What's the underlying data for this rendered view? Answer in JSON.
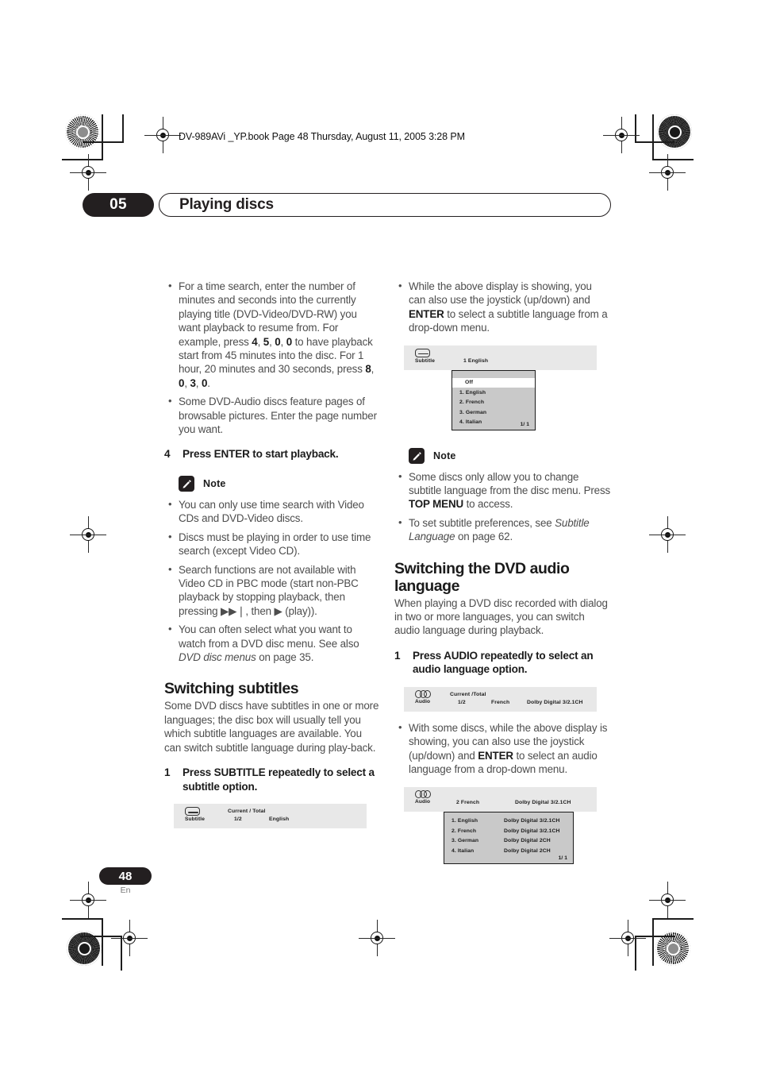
{
  "print_header": {
    "text": "DV-989AVi _YP.book  Page 48  Thursday, August 11, 2005  3:28 PM"
  },
  "chapter": {
    "number": "05",
    "title": "Playing discs"
  },
  "footer": {
    "page_number": "48",
    "language_code": "En"
  },
  "left_column": {
    "bullets_top": [
      "For a time search, enter the number of minutes and seconds into the currently playing title (DVD-Video/DVD-RW) you want playback to resume from. For example, press <b>4</b>, <b>5</b>, <b>0</b>, <b>0</b> to have playback start from 45 minutes into the disc. For 1 hour, 20 minutes and 30 seconds, press <b>8</b>, <b>0</b>, <b>3</b>, <b>0</b>.",
      "Some DVD-Audio discs feature pages of browsable pictures. Enter the page number you want."
    ],
    "step4": {
      "number": "4",
      "text": "Press ENTER to start playback."
    },
    "note_label": "Note",
    "note_bullets": [
      "You can only use time search with Video CDs and DVD-Video discs.",
      "Discs must be playing in order to use time search (except Video CD).",
      "Search functions are not available with Video CD in PBC mode (start non-PBC playback by stopping playback, then pressing ▶▶❘, then ▶ (play)).",
      "You can often select what you want to watch from a DVD disc menu. See also <i>DVD disc menus</i> on page 35."
    ],
    "section_heading": "Switching subtitles",
    "section_body": "Some DVD discs have subtitles in one or more languages; the disc box will usually tell you which subtitle languages are available. You can switch subtitle language during play-back.",
    "step1": {
      "number": "1",
      "text": "Press SUBTITLE repeatedly to select a subtitle option."
    },
    "osd_subtitle_bar": {
      "icon": "subtitle-icon",
      "icon_label": "Subtitle",
      "header_label": "Current / Total",
      "current_total": "1/2",
      "language": "English"
    }
  },
  "right_column": {
    "bullet_top": "While the above display is showing, you can also use the joystick (up/down) and <b>ENTER</b> to select a subtitle language from a drop-down menu.",
    "osd_subtitle_menu": {
      "icon": "subtitle-icon",
      "icon_label": "Subtitle",
      "selection": "1  English",
      "rows": [
        {
          "label": "Off",
          "highlight": true
        },
        {
          "label": "1. English",
          "highlight": false
        },
        {
          "label": "2. French",
          "highlight": false
        },
        {
          "label": "3. German",
          "highlight": false
        },
        {
          "label": "4. Italian",
          "highlight": false
        }
      ],
      "pager": "1/ 1"
    },
    "note_label": "Note",
    "note_bullets": [
      "Some discs only allow you to change subtitle language from the disc menu. Press <b>TOP MENU</b> to access.",
      "To set subtitle preferences, see <i>Subtitle Language</i> on page 62."
    ],
    "section_heading": "Switching the DVD audio language",
    "section_body": "When playing a DVD disc recorded with dialog in two or more languages, you can switch audio language during playback.",
    "step1": {
      "number": "1",
      "text": "Press AUDIO repeatedly to select an audio language option."
    },
    "osd_audio_bar": {
      "icon": "audio-icon",
      "icon_label": "Audio",
      "header_label": "Current /Total",
      "current_total": "1/2",
      "language": "French",
      "format": "Dolby Digital 3/2.1CH"
    },
    "bullet_mid": "With some discs, while the above display is showing, you can also use the joystick (up/down) and <b>ENTER</b> to select an audio language from a drop-down menu.",
    "osd_audio_menu": {
      "icon": "audio-icon",
      "icon_label": "Audio",
      "selection": "2  French",
      "selection_format": "Dolby Digital 3/2.1CH",
      "rows": [
        {
          "label": "1. English",
          "format": "Dolby Digital 3/2.1CH"
        },
        {
          "label": "2. French",
          "format": "Dolby Digital 3/2.1CH"
        },
        {
          "label": "3. German",
          "format": "Dolby Digital 2CH"
        },
        {
          "label": "4. Italian",
          "format": "Dolby Digital 2CH"
        }
      ],
      "pager": "1/ 1"
    }
  },
  "colors": {
    "ink": "#231f20",
    "body_text": "#4d4d4d",
    "osd_bar": "#e8e8e8",
    "osd_menu": "#c9c9c9"
  }
}
